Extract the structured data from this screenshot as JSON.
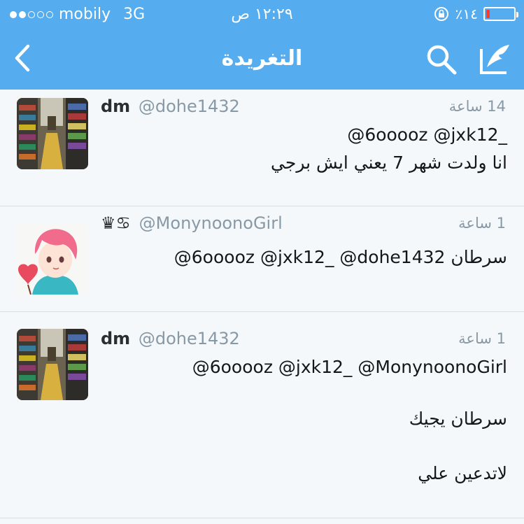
{
  "status_bar": {
    "carrier": "mobily",
    "network": "3G",
    "time": "١٢:٢٩ ص",
    "battery": "٪١٤",
    "battery_level": 0.14
  },
  "nav": {
    "title": "التغريدة",
    "back_icon": "chevron-left-icon",
    "search_icon": "search-icon",
    "compose_icon": "compose-tweet-icon"
  },
  "tweets": [
    {
      "name": "dm",
      "handle": "@dohe1432",
      "time": "14 ساعة",
      "lines": [
        "@6ooooz @jxk12_",
        "انا ولدت شهر 7 يعني ايش برجي"
      ]
    },
    {
      "name": "",
      "badges": "♛♋",
      "handle": "@MonynoonoGirl",
      "time": "1 ساعة",
      "lines": [
        "@6ooooz @jxk12_ @dohe1432 سرطان"
      ]
    },
    {
      "name": "dm",
      "handle": "@dohe1432",
      "time": "1 ساعة",
      "lines": [
        "@6ooooz @jxk12_ @MonynoonoGirl",
        "سرطان يجيك",
        "لاتدعين علي"
      ]
    }
  ]
}
